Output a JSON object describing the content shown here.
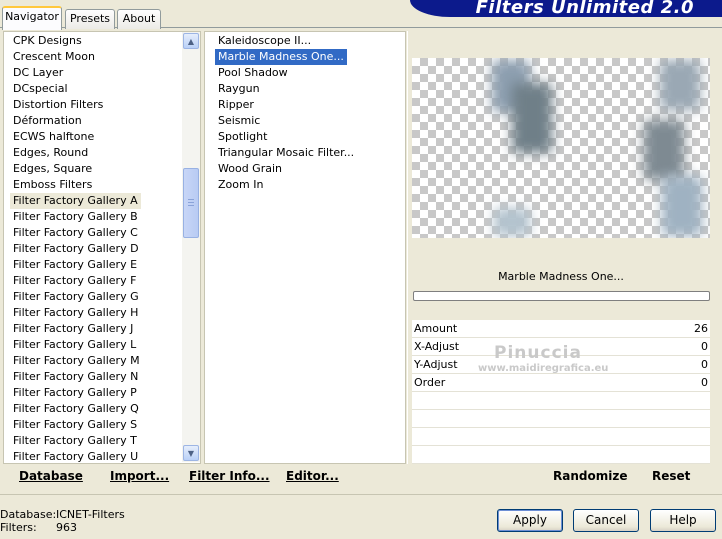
{
  "tabs": [
    {
      "label": "Navigator"
    },
    {
      "label": "Presets"
    },
    {
      "label": "About"
    }
  ],
  "app_title": "Filters Unlimited 2.0",
  "categories": [
    "CPK Designs",
    "Crescent Moon",
    "DC Layer",
    "DCspecial",
    "Distortion Filters",
    "Déformation",
    "ECWS halftone",
    "Edges, Round",
    "Edges, Square",
    "Emboss Filters",
    "Filter Factory Gallery A",
    "Filter Factory Gallery B",
    "Filter Factory Gallery C",
    "Filter Factory Gallery D",
    "Filter Factory Gallery E",
    "Filter Factory Gallery F",
    "Filter Factory Gallery G",
    "Filter Factory Gallery H",
    "Filter Factory Gallery J",
    "Filter Factory Gallery L",
    "Filter Factory Gallery M",
    "Filter Factory Gallery N",
    "Filter Factory Gallery P",
    "Filter Factory Gallery Q",
    "Filter Factory Gallery S",
    "Filter Factory Gallery T",
    "Filter Factory Gallery U"
  ],
  "selected_category": "Filter Factory Gallery A",
  "filters": [
    "Kaleidoscope II...",
    "Marble Madness One...",
    "Pool Shadow",
    "Raygun",
    "Ripper",
    "Seismic",
    "Spotlight",
    "Triangular Mosaic Filter...",
    "Wood Grain",
    "Zoom In"
  ],
  "selected_filter": "Marble Madness One...",
  "preview_filter_name": "Marble Madness One...",
  "params": [
    {
      "label": "Amount",
      "value": "26"
    },
    {
      "label": "X-Adjust",
      "value": "0"
    },
    {
      "label": "Y-Adjust",
      "value": "0"
    },
    {
      "label": "Order",
      "value": "0"
    }
  ],
  "watermark": {
    "line1": "Pinuccia",
    "line2": "www.maidiregrafica.eu"
  },
  "links": {
    "database": "Database",
    "import": "Import...",
    "filter_info": "Filter Info...",
    "editor": "Editor...",
    "randomize": "Randomize",
    "reset": "Reset"
  },
  "footer": {
    "database_label": "Database:",
    "database_value": "ICNET-Filters",
    "filters_label": "Filters:",
    "filters_value": "963"
  },
  "buttons": {
    "apply": "Apply",
    "cancel": "Cancel",
    "help": "Help"
  },
  "colors": {
    "banner": "#0c1a8c",
    "highlight": "#316ac5",
    "background": "#ece9d8"
  }
}
